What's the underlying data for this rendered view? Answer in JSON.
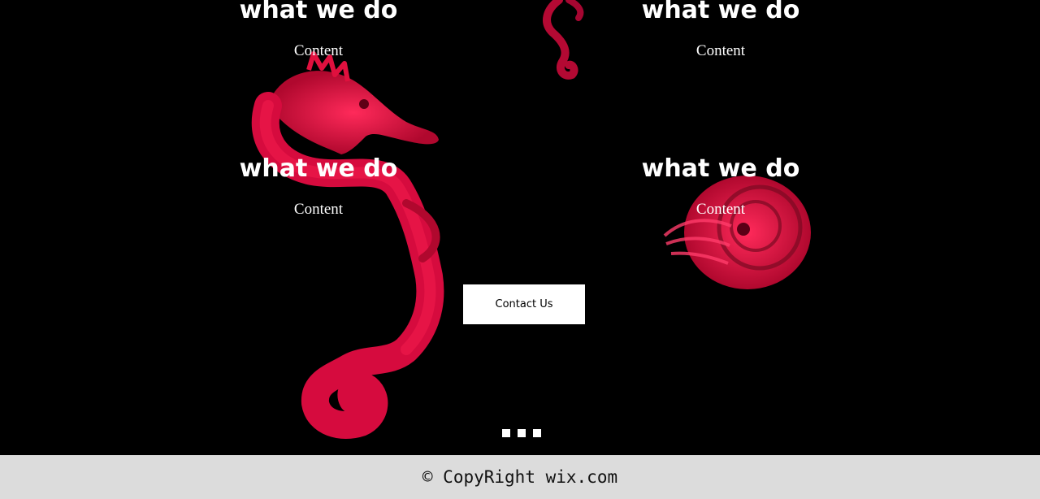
{
  "features": [
    {
      "title": "what we do",
      "body": "Content"
    },
    {
      "title": "what we do",
      "body": "Content"
    },
    {
      "title": "what we do",
      "body": "Content"
    },
    {
      "title": "what we do",
      "body": "Content"
    }
  ],
  "cta": {
    "label": "Contact Us"
  },
  "slider": {
    "dots": 3,
    "color": "#ffffff"
  },
  "footer": {
    "copyright": "© CopyRight wix.com"
  },
  "colors": {
    "background": "#000000",
    "accent": "#e0103e",
    "footer_bg": "#dcdcdc"
  }
}
